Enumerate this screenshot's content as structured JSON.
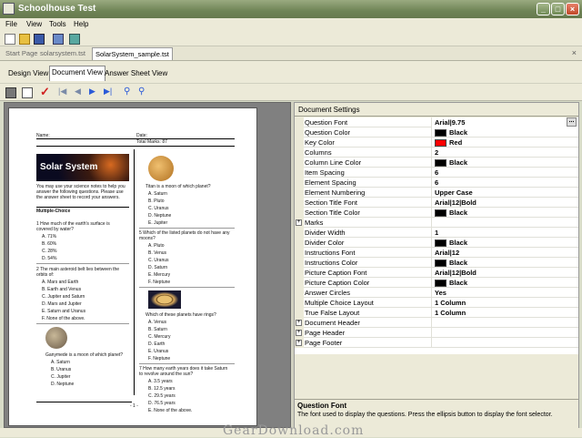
{
  "window": {
    "title": "Schoolhouse Test"
  },
  "menu": [
    "File",
    "View",
    "Tools",
    "Help"
  ],
  "doc_tabs": [
    "Start Page",
    "solarsystem.tst",
    "SolarSystem_sample.tst"
  ],
  "view_tabs": [
    "Design View",
    "Document View",
    "Answer Sheet View"
  ],
  "settings": {
    "header": "Document Settings",
    "rows": [
      {
        "name": "Question Font",
        "value": "Arial|9.75",
        "ellipsis": true
      },
      {
        "name": "Question Color",
        "value": "Black",
        "swatch": "#000000"
      },
      {
        "name": "Key Color",
        "value": "Red",
        "swatch": "#ff0000"
      },
      {
        "name": "Columns",
        "value": "2"
      },
      {
        "name": "Column Line Color",
        "value": "Black",
        "swatch": "#000000"
      },
      {
        "name": "Item Spacing",
        "value": "6"
      },
      {
        "name": "Element Spacing",
        "value": "6"
      },
      {
        "name": "Element Numbering",
        "value": "Upper Case"
      },
      {
        "name": "Section Title Font",
        "value": "Arial|12|Bold"
      },
      {
        "name": "Section Title Color",
        "value": "Black",
        "swatch": "#000000"
      },
      {
        "name": "Marks",
        "value": "",
        "expand": true
      },
      {
        "name": "Divider Width",
        "value": "1"
      },
      {
        "name": "Divider Color",
        "value": "Black",
        "swatch": "#000000"
      },
      {
        "name": "Instructions Font",
        "value": "Arial|12"
      },
      {
        "name": "Instructions Color",
        "value": "Black",
        "swatch": "#000000"
      },
      {
        "name": "Picture Caption Font",
        "value": "Arial|12|Bold"
      },
      {
        "name": "Picture Caption Color",
        "value": "Black",
        "swatch": "#000000"
      },
      {
        "name": "Answer Circles",
        "value": "Yes"
      },
      {
        "name": "Multiple Choice Layout",
        "value": "1 Column"
      },
      {
        "name": "True False Layout",
        "value": "1 Column"
      },
      {
        "name": "Document Header",
        "value": "",
        "expand": true
      },
      {
        "name": "Page Header",
        "value": "",
        "expand": true
      },
      {
        "name": "Page Footer",
        "value": "",
        "expand": true
      }
    ],
    "desc_title": "Question Font",
    "desc_text": "The font used to display the questions. Press the ellipsis button to display the font selector."
  },
  "page": {
    "name_label": "Name:",
    "date_label": "Date:",
    "total_marks": "Total Marks: 87",
    "banner": "Solar System",
    "instructions": "You may use your science notes to help you answer the following questions. Please use the answer sheet to record your answers.",
    "section": "Multiple-Choice",
    "q1": "1   How much of the earth's surface is covered by water?",
    "q1_opts": [
      "A. 71%",
      "B. 60%",
      "C. 28%",
      "D. 54%"
    ],
    "q2": "2   The main asteroid belt lies between the orbits of:",
    "q2_opts": [
      "A. Mars and Earth",
      "B. Earth and Venus",
      "C. Jupiter and Saturn",
      "D. Mars and Jupiter",
      "E. Saturn and Uranus",
      "F. None of the above."
    ],
    "q3": "Ganymede is a moon of which planet?",
    "q3_opts": [
      "A. Saturn",
      "B. Uranus",
      "C. Jupiter",
      "D. Neptune"
    ],
    "q4": "Titan is a moon of which planet?",
    "q4_opts": [
      "A. Saturn",
      "B. Pluto",
      "C. Uranus",
      "D. Neptune",
      "E. Jupiter"
    ],
    "q5": "5   Which of the listed planets do not have any moons?",
    "q5_opts": [
      "A. Pluto",
      "B. Venus",
      "C. Uranus",
      "D. Saturn",
      "E. Mercury",
      "F. Neptune"
    ],
    "q6": "Which of these planets have rings?",
    "q6_opts": [
      "A. Venus",
      "B. Saturn",
      "C. Mercury",
      "D. Earth",
      "E. Uranus",
      "F. Neptune"
    ],
    "q7": "7   How many earth years does it take Saturn to revolve around the sun?",
    "q7_opts": [
      "A. 3.5 years",
      "B. 12.5 years",
      "C. 29.5 years",
      "D. 76.5 years",
      "E. None of the above."
    ],
    "footer": "- 1 -"
  },
  "watermark": "GearDownload.com"
}
